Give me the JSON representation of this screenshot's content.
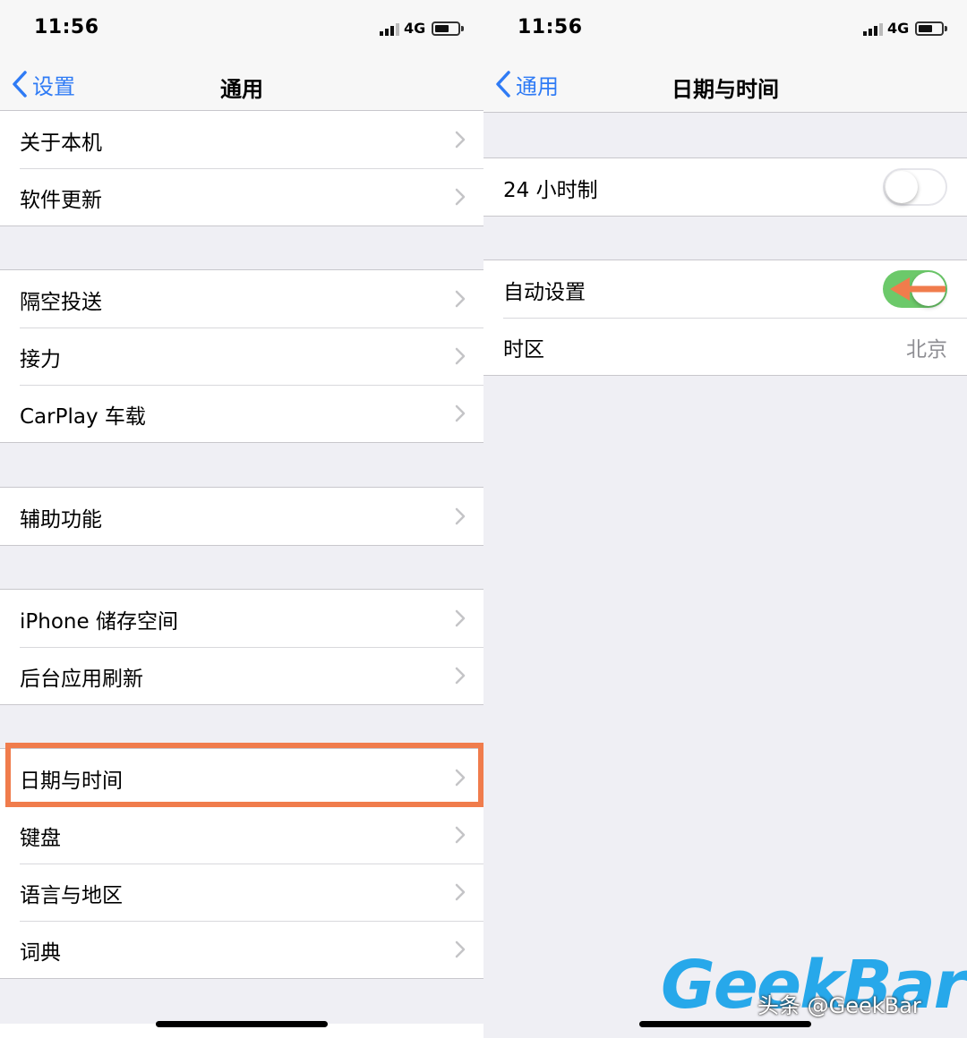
{
  "status": {
    "time": "11:56",
    "network": "4G"
  },
  "colors": {
    "accent": "#2f7bf5",
    "toggle_on": "#6cc96a",
    "highlight": "#f07c4c",
    "watermark": "#27a8ea"
  },
  "left": {
    "back_label": "设置",
    "title": "通用",
    "groups": [
      [
        "关于本机",
        "软件更新"
      ],
      [
        "隔空投送",
        "接力",
        "CarPlay 车载"
      ],
      [
        "辅助功能"
      ],
      [
        "iPhone 储存空间",
        "后台应用刷新"
      ],
      [
        "日期与时间",
        "键盘",
        "语言与地区",
        "词典"
      ]
    ],
    "highlighted_item": "日期与时间"
  },
  "right": {
    "back_label": "通用",
    "title": "日期与时间",
    "hour24": {
      "label": "24 小时制",
      "on": false
    },
    "auto_set": {
      "label": "自动设置",
      "on": true
    },
    "timezone": {
      "label": "时区",
      "value": "北京"
    }
  },
  "watermark": {
    "logo": "GeekBar",
    "caption": "头条 @GeekBar"
  },
  "icons": {
    "back": "chevron-left-icon",
    "disclosure": "chevron-right-icon",
    "signal": "signal-icon",
    "battery": "battery-icon",
    "annotation": "arrow-left-icon"
  }
}
